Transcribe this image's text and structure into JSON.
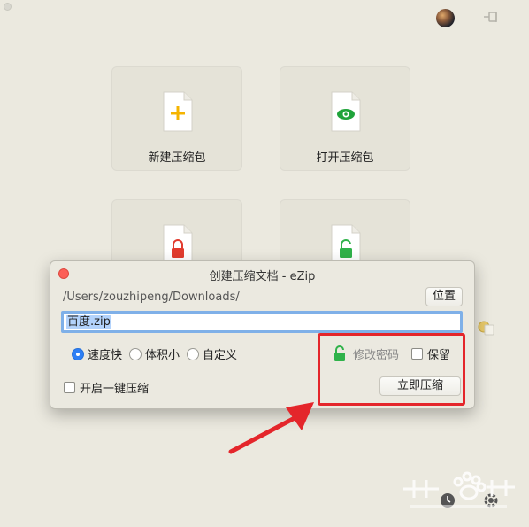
{
  "home": {
    "tiles": [
      {
        "label": "新建压缩包",
        "icon": "add-file-icon"
      },
      {
        "label": "打开压缩包",
        "icon": "view-file-icon"
      },
      {
        "label": "",
        "icon": "lock-file-icon"
      },
      {
        "label": "",
        "icon": "unlock-file-icon"
      }
    ]
  },
  "dialog": {
    "title": "创建压缩文档 - eZip",
    "path": "/Users/zouzhipeng/Downloads/",
    "location_label": "位置",
    "filename": "百度.zip",
    "options": [
      "速度快",
      "体积小",
      "自定义"
    ],
    "selected_option": "速度快",
    "password_label": "修改密码",
    "keep_label": "保留",
    "oneclick_label": "开启一键压缩",
    "compress_label": "立即压缩"
  },
  "colors": {
    "accent_blue": "#2d7ff5",
    "plus_yellow": "#f5b400",
    "eye_green": "#1fa33a",
    "lock_red": "#e23b2e",
    "lock_green": "#2fb24a",
    "annotation_red": "#e4262b"
  }
}
